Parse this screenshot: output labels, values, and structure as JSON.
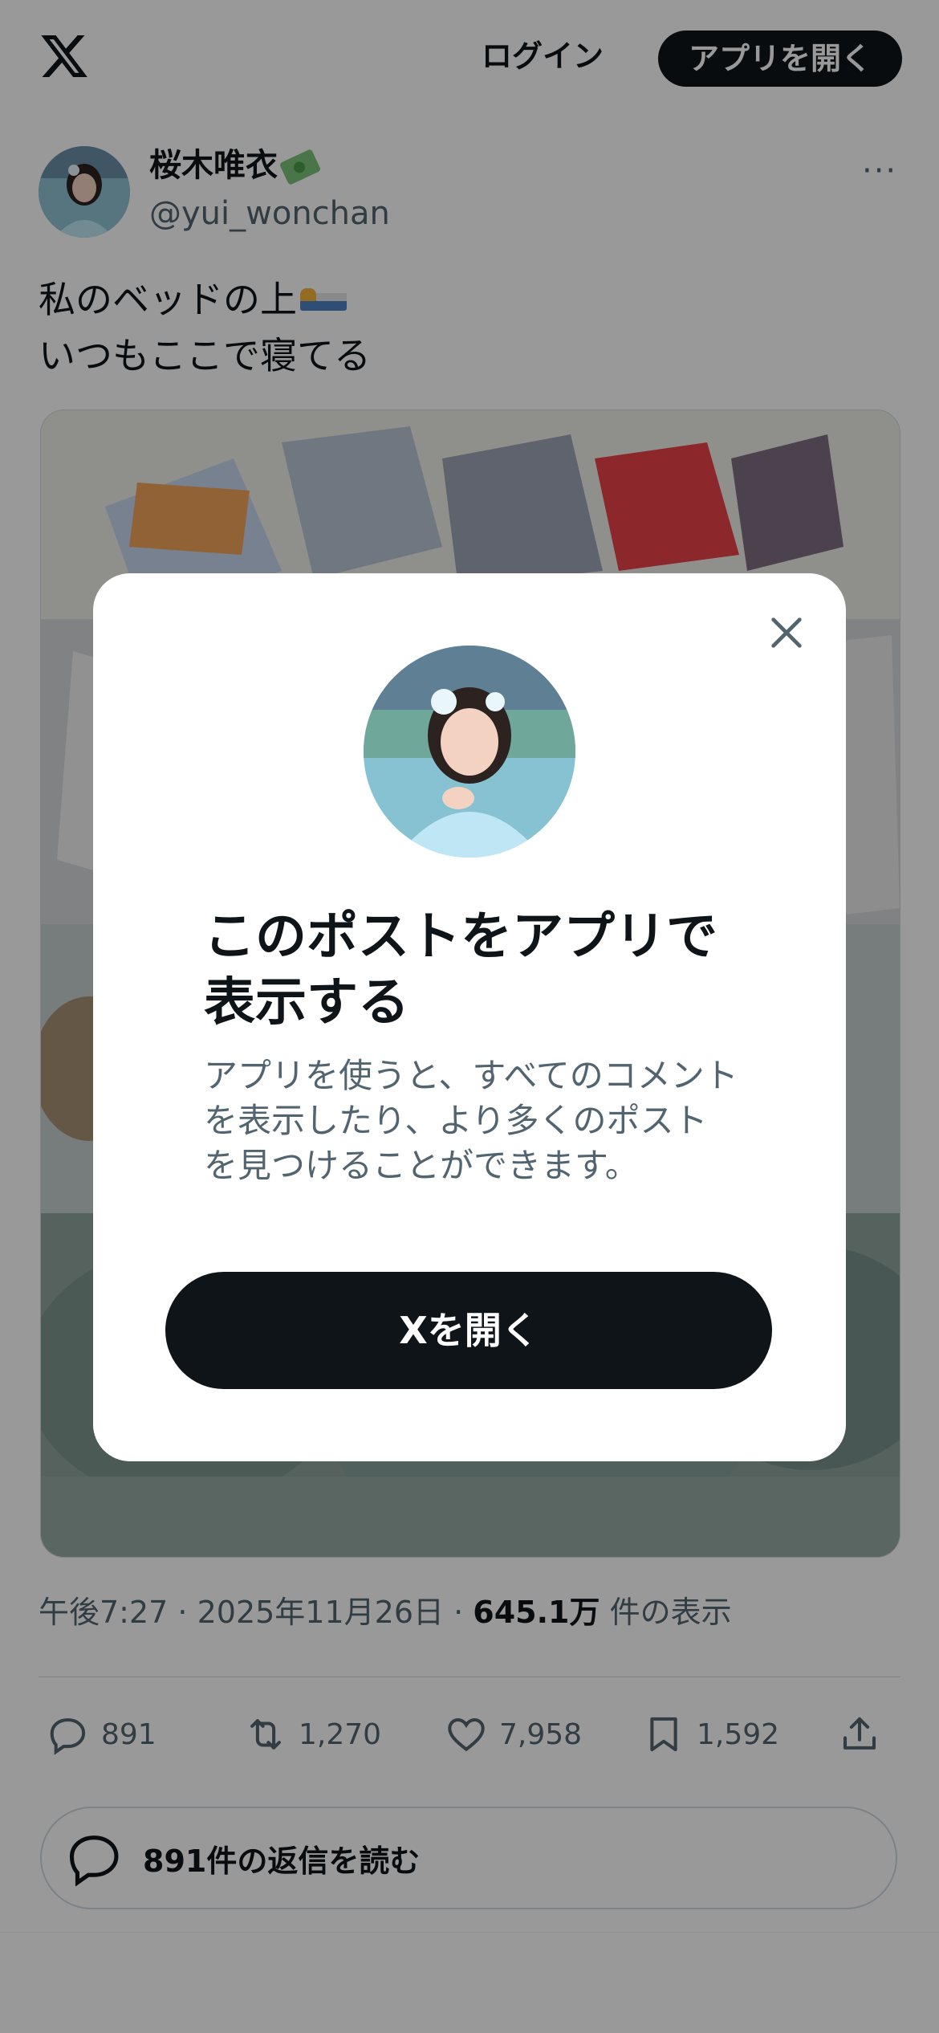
{
  "header": {
    "login_label": "ログイン",
    "open_app_label": "アプリを開く",
    "logo_icon": "x-logo-icon"
  },
  "post": {
    "display_name": "桜木唯衣",
    "handle": "@yui_wonchan",
    "text_line1": "私のベッドの上",
    "text_line2": "いつもここで寝てる",
    "time": "午後7:27",
    "date": "2025年11月26日",
    "views_value": "645.1万",
    "views_label": "件の表示",
    "more_label": "···"
  },
  "actions": {
    "replies": "891",
    "reposts": "1,270",
    "likes": "7,958",
    "bookmarks": "1,592"
  },
  "read_replies_label": "891件の返信を読む",
  "modal": {
    "title_line1": "このポストをアプリで",
    "title_line2": "表示する",
    "desc_line1": "アプリを使うと、すべてのコメント",
    "desc_line2": "を表示したり、より多くのポスト",
    "desc_line3": "を見つけることができます。",
    "open_button_label": "Xを開く"
  },
  "colors": {
    "primary": "#0f1419",
    "secondary": "#536471",
    "border": "#cfd9de"
  }
}
